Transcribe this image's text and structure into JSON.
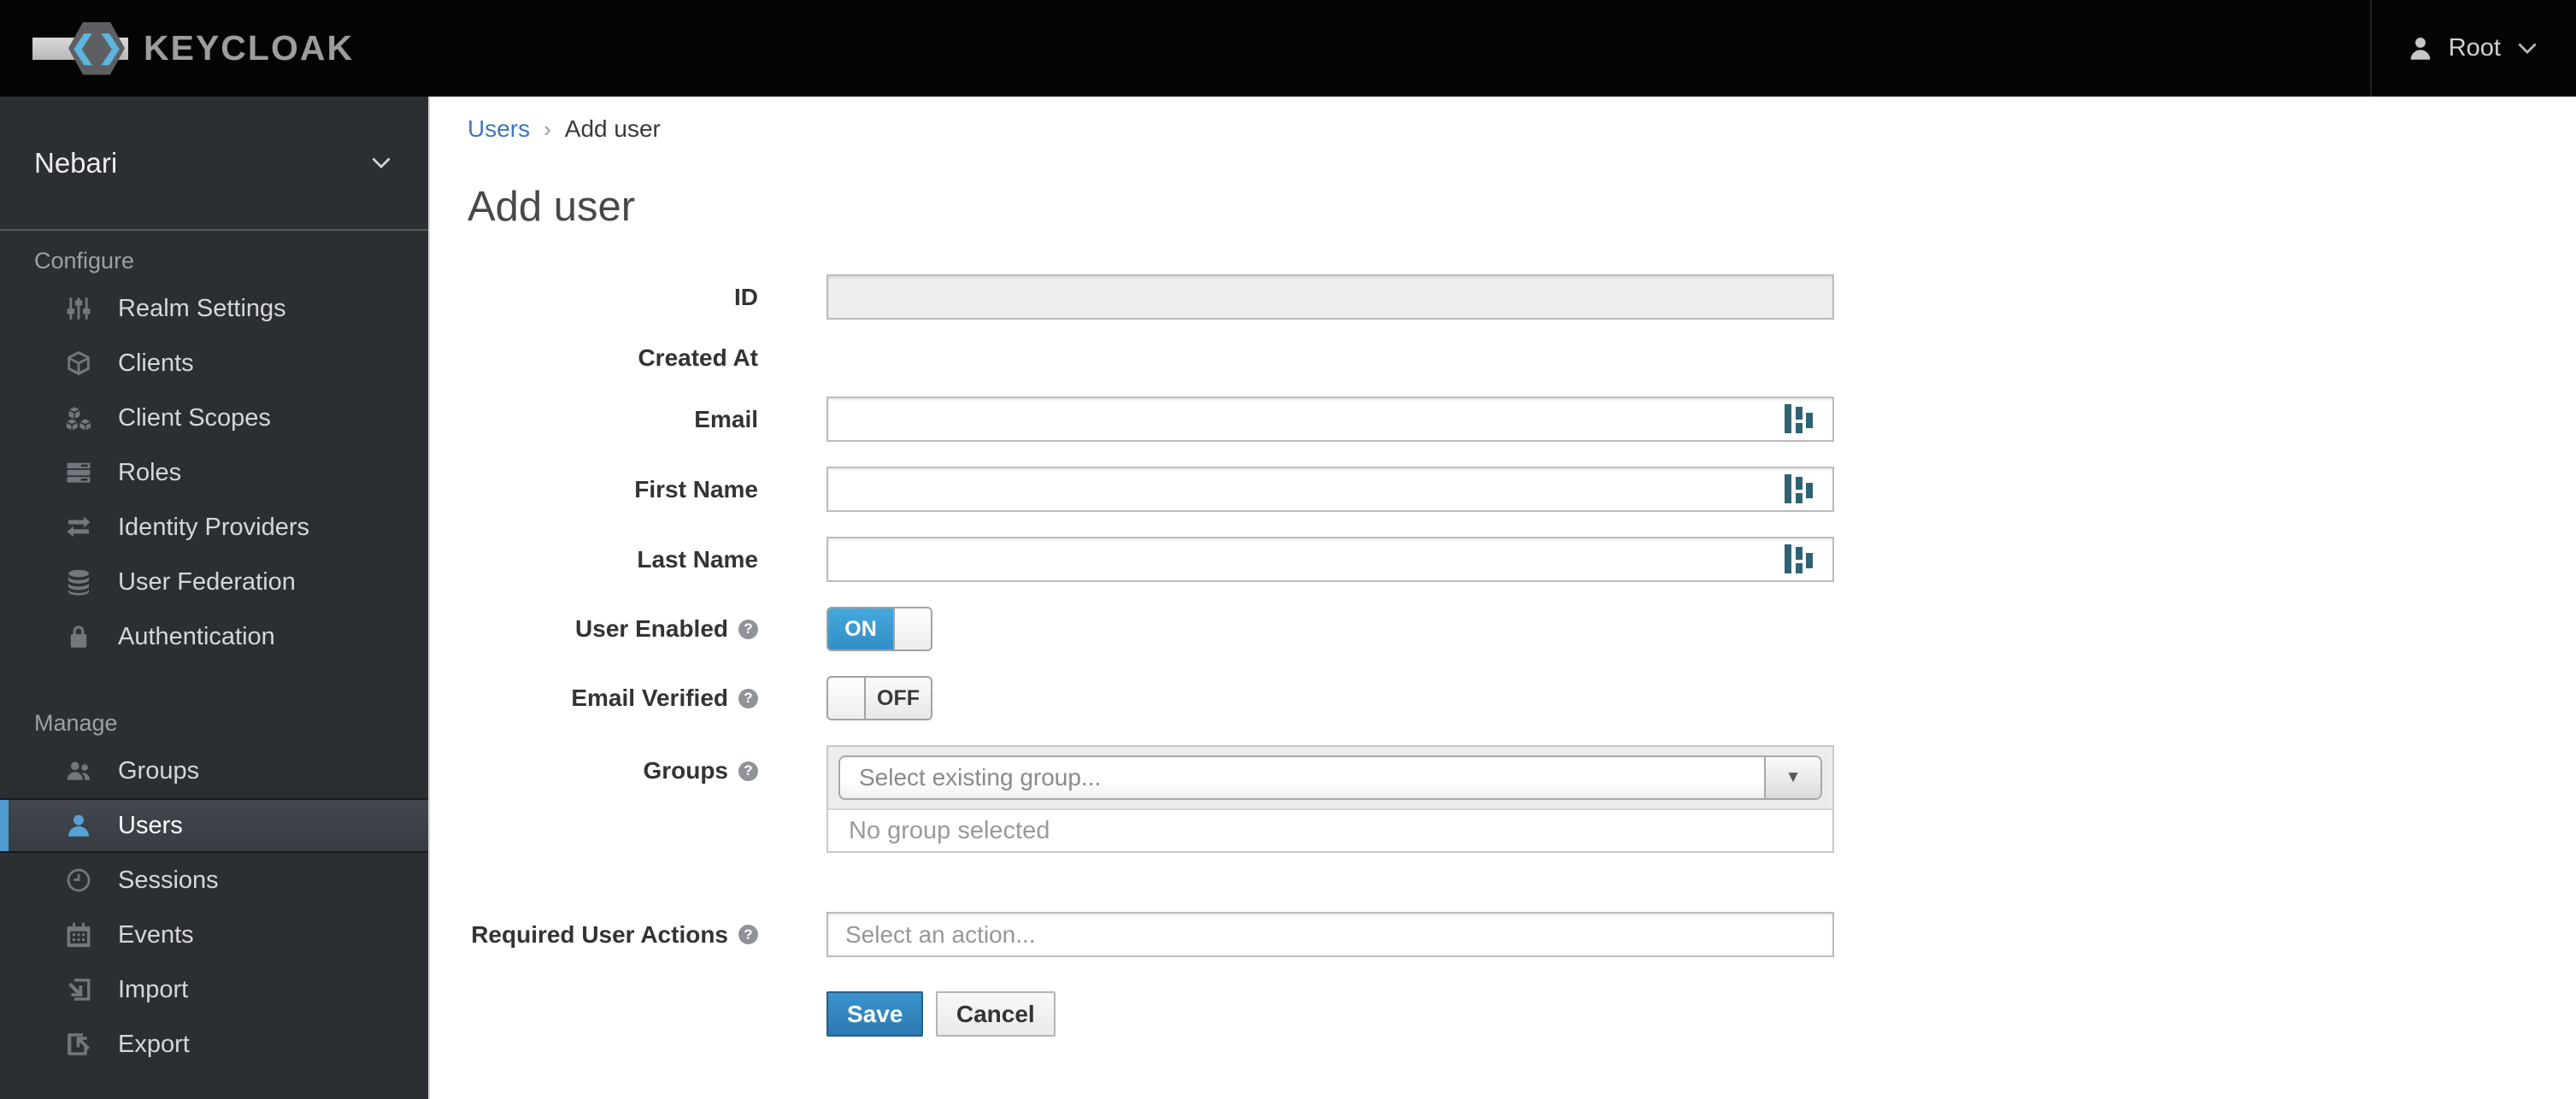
{
  "topbar": {
    "brand": "KEYCLOAK",
    "brand_glyphs": "❮❯",
    "user_label": "Root"
  },
  "sidebar": {
    "realm": "Nebari",
    "sections": [
      {
        "label": "Configure",
        "items": [
          {
            "label": "Realm Settings",
            "icon": "sliders-icon"
          },
          {
            "label": "Clients",
            "icon": "cube-icon"
          },
          {
            "label": "Client Scopes",
            "icon": "cubes-icon"
          },
          {
            "label": "Roles",
            "icon": "list-icon"
          },
          {
            "label": "Identity Providers",
            "icon": "exchange-icon"
          },
          {
            "label": "User Federation",
            "icon": "database-icon"
          },
          {
            "label": "Authentication",
            "icon": "lock-icon"
          }
        ]
      },
      {
        "label": "Manage",
        "items": [
          {
            "label": "Groups",
            "icon": "users-group-icon"
          },
          {
            "label": "Users",
            "icon": "user-icon",
            "selected": true
          },
          {
            "label": "Sessions",
            "icon": "clock-icon"
          },
          {
            "label": "Events",
            "icon": "calendar-icon"
          },
          {
            "label": "Import",
            "icon": "import-icon"
          },
          {
            "label": "Export",
            "icon": "export-icon"
          }
        ]
      }
    ]
  },
  "breadcrumb": {
    "parent": "Users",
    "separator": "›",
    "current": "Add user"
  },
  "main": {
    "title": "Add user",
    "form": {
      "id": {
        "label": "ID",
        "value": ""
      },
      "created_at": {
        "label": "Created At",
        "value": ""
      },
      "email": {
        "label": "Email",
        "value": ""
      },
      "first_name": {
        "label": "First Name",
        "value": ""
      },
      "last_name": {
        "label": "Last Name",
        "value": ""
      },
      "user_enabled": {
        "label": "User Enabled",
        "state": "ON"
      },
      "email_verified": {
        "label": "Email Verified",
        "state": "OFF"
      },
      "groups": {
        "label": "Groups",
        "placeholder": "Select existing group...",
        "empty_text": "No group selected"
      },
      "required_user_actions": {
        "label": "Required User Actions",
        "placeholder": "Select an action..."
      },
      "save_label": "Save",
      "cancel_label": "Cancel"
    }
  },
  "icons": {
    "help_glyph": "?",
    "dropdown_arrow": "▼"
  },
  "colors": {
    "accent_blue": "#3da0d9",
    "link_blue": "#3c78be",
    "sidebar_bg": "#2b2e33",
    "topbar_bg": "#040404",
    "selected_item_bar": "#4f9cd1",
    "save_button": "#2b79af"
  }
}
